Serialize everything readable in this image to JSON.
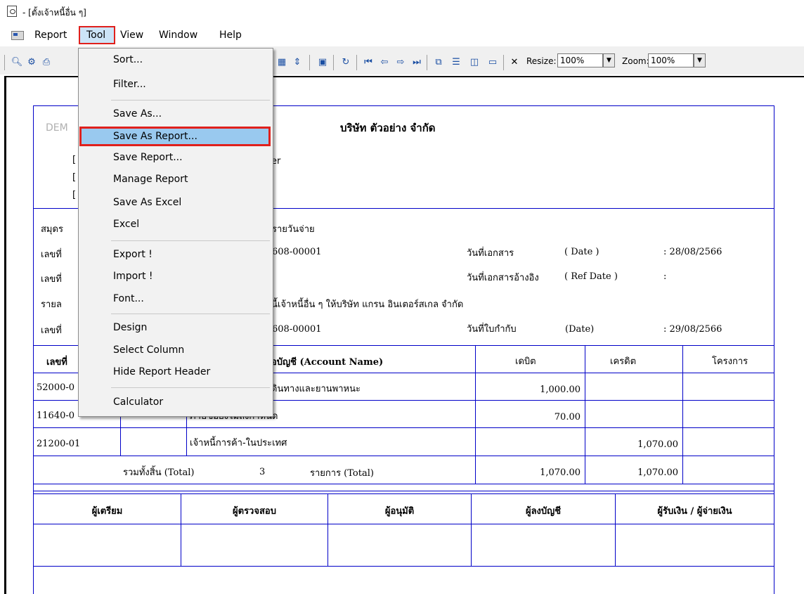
{
  "window": {
    "title": "- [ตั้งเจ้าหนี้อื่น ๆ]"
  },
  "menubar": {
    "items": [
      "Report",
      "Tool",
      "View",
      "Window",
      "Help"
    ]
  },
  "toolbar": {
    "resize_label": "Resize:",
    "resize_value": "100%",
    "zoom_label": "Zoom:",
    "zoom_value": "100%"
  },
  "dropdown": {
    "items": [
      "Sort...",
      "Filter...",
      "Save As...",
      "Save As Report...",
      "Save Report...",
      "Manage Report",
      "Save As Excel",
      "Excel",
      "Export !",
      "Import !",
      "Font...",
      "Design",
      "Select Column",
      "Hide Report Header",
      "Calculator"
    ],
    "highlighted": "Save As Report..."
  },
  "report": {
    "company_partial": "DEM",
    "company_name": "บริษัท ตัวอย่าง จำกัด",
    "header_partial": "er",
    "book_label": "สมุดร",
    "book_value": "รายวันจ่าย",
    "doc_no_label": "เลขที่",
    "doc_no_value": "608-00001",
    "doc_date_label": "วันที่เอกสาร",
    "doc_date_en": "( Date )",
    "doc_date_value": ":  28/08/2566",
    "ref_no_label": "เลขที่",
    "ref_date_label": "วันที่เอกสารอ้างอิง",
    "ref_date_en": "( Ref Date )",
    "ref_date_value": ":",
    "detail_label": "รายล",
    "detail_value": "นี้เจ้าหนี้อื่น ๆ ให้บริษัท แกรน อินเตอร์สเกล จำกัด",
    "inv_no_label": "เลขที่",
    "inv_no_value": "608-00001",
    "inv_date_label": "วันที่ใบกำกับ",
    "inv_date_en": "(Date)",
    "inv_date_value": ":  29/08/2566",
    "columns": {
      "acct_no": "เลขที่",
      "acct_name": "อบัญชี (Account Name)",
      "debit": "เดบิต",
      "credit": "เครดิต",
      "project": "โครงการ"
    },
    "rows": [
      {
        "code": "52000-0",
        "name": "ดินทางและยานพาหนะ",
        "debit": "1,000.00",
        "credit": ""
      },
      {
        "code": "11640-0",
        "name": "ภาษีซื้อยังไม่ถึงกำหนด",
        "debit": "70.00",
        "credit": ""
      },
      {
        "code": "21200-01",
        "name": "เจ้าหนี้การค้า-ในประเทศ",
        "debit": "",
        "credit": "1,070.00"
      }
    ],
    "total_label": "รวมทั้งสิ้น (Total)",
    "total_count": "3",
    "total_items_label": "รายการ (Total)",
    "total_debit": "1,070.00",
    "total_credit": "1,070.00",
    "signatures": [
      "ผู้เตรียม",
      "ผู้ตรวจสอบ",
      "ผู้อนุมัติ",
      "ผู้ลงบัญชี",
      "ผู้รับเงิน / ผู้จ่ายเงิน"
    ]
  }
}
